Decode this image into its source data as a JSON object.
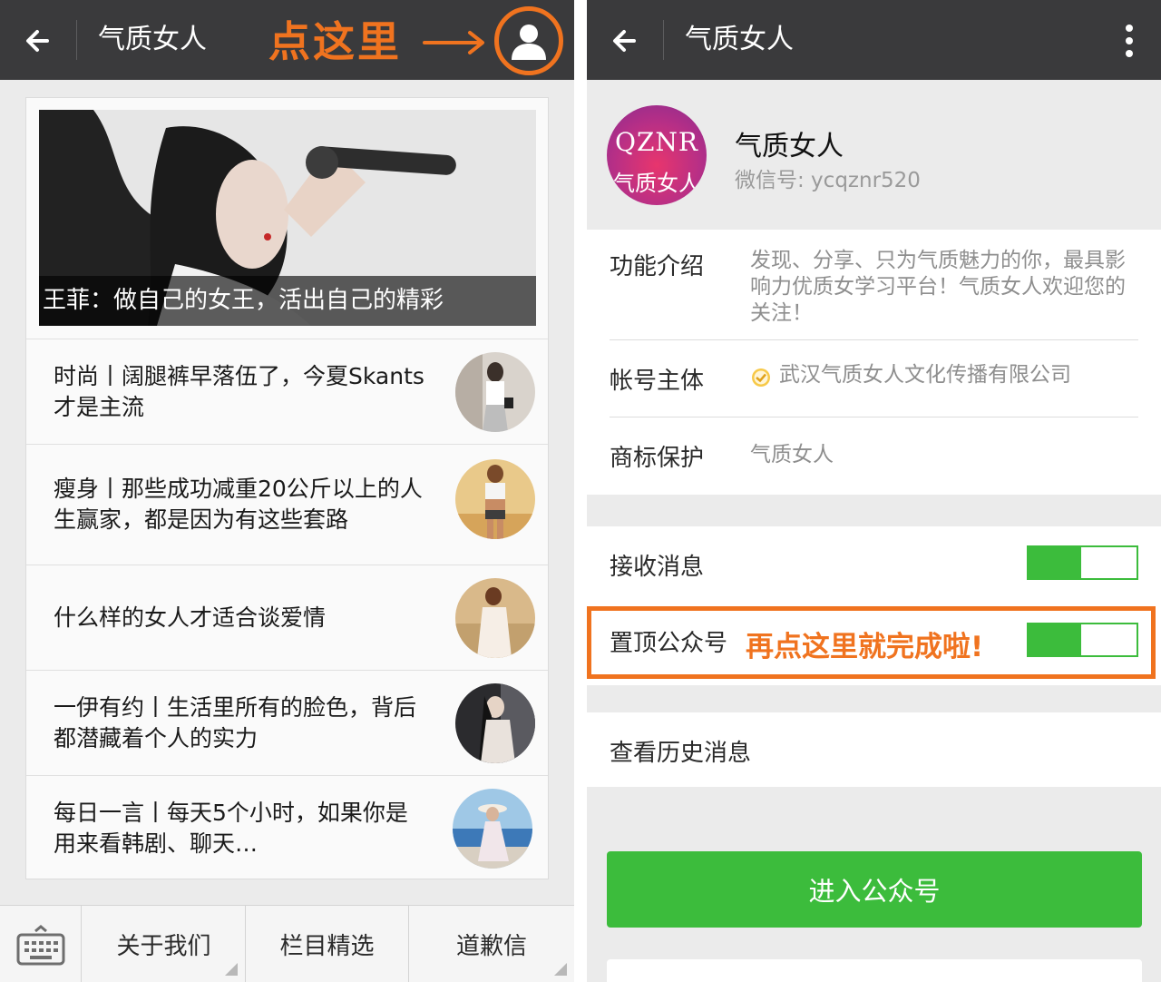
{
  "left": {
    "header": {
      "title": "气质女人",
      "annotation": "点这里"
    },
    "cover": {
      "caption": "王菲：做自己的女王，活出自己的精彩"
    },
    "articles": [
      {
        "title": "时尚丨阔腿裤早落伍了，今夏Skants才是主流"
      },
      {
        "title": "瘦身丨那些成功减重20公斤以上的人生赢家，都是因为有这些套路"
      },
      {
        "title": "什么样的女人才适合谈爱情"
      },
      {
        "title": "一伊有约丨生活里所有的脸色，背后都潜藏着个人的实力"
      },
      {
        "title": "每日一言丨每天5个小时，如果你是用来看韩剧、聊天…"
      }
    ],
    "menu": [
      "关于我们",
      "栏目精选",
      "道歉信"
    ],
    "icons": [
      "back-arrow-icon",
      "person-icon",
      "keyboard-icon"
    ]
  },
  "right": {
    "header": {
      "title": "气质女人"
    },
    "profile": {
      "name": "气质女人",
      "wechat_id": "微信号: ycqznr520",
      "logo_text": "QZNR",
      "logo_cn": "气质女人"
    },
    "info": [
      {
        "label": "功能介绍",
        "value": "发现、分享、只为气质魅力的你，最具影响力优质女学习平台！气质女人欢迎您的关注！"
      },
      {
        "label": "帐号主体",
        "value": "武汉气质女人文化传播有限公司"
      },
      {
        "label": "商标保护",
        "value": "气质女人"
      }
    ],
    "toggles": [
      {
        "label": "接收消息",
        "on": true
      },
      {
        "label": "置顶公众号",
        "on": true
      }
    ],
    "annotation": "再点这里就完成啦!",
    "history_label": "查看历史消息",
    "enter_button": "进入公众号",
    "colors": {
      "accent_green": "#3cbc3c",
      "annotation_orange": "#f0731f",
      "topbar": "#3a3a3c"
    }
  }
}
